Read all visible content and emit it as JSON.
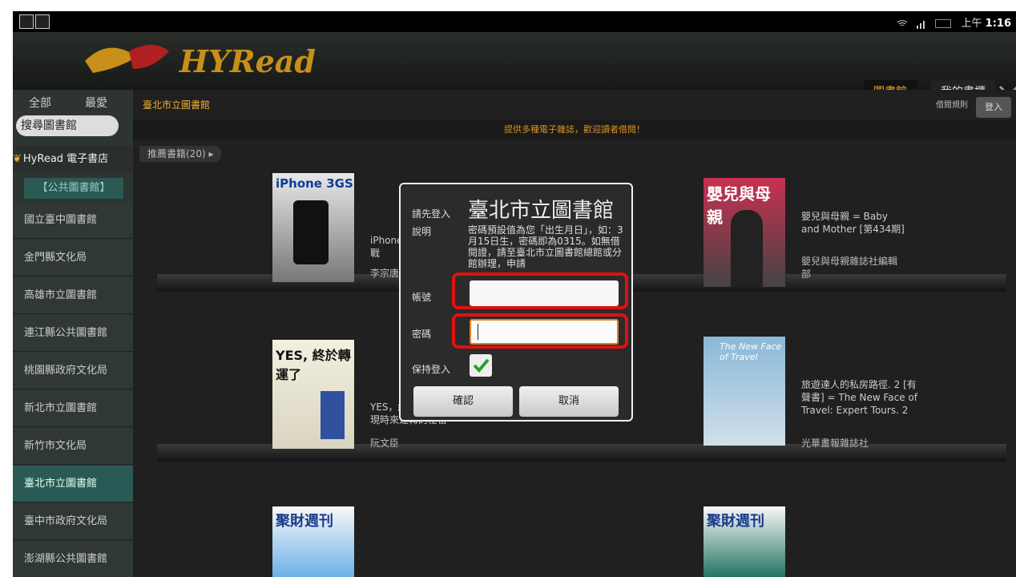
{
  "status_bar": {
    "time_prefix": "上午",
    "time": "1:16"
  },
  "header": {
    "logo_text": "HYRead",
    "tabs": [
      {
        "label": "圖書館",
        "active": true
      },
      {
        "label": "我的書櫃",
        "active": false
      }
    ]
  },
  "sidebar": {
    "tab_all": "全部",
    "tab_favorites": "最愛",
    "search_label": "搜尋圖書館",
    "store_label": "HyRead 電子書店",
    "category": "【公共圖書館】",
    "items": [
      "國立臺中圖書館",
      "金門縣文化局",
      "高雄市立圖書館",
      "連江縣公共圖書館",
      "桃園縣政府文化局",
      "新北市立圖書館",
      "新竹市文化局",
      "臺北市立圖書館",
      "臺中市政府文化局",
      "澎湖縣公共圖書館"
    ],
    "selected": "臺北市立圖書館"
  },
  "main": {
    "library_title": "臺北市立圖書館",
    "rules_label": "借閱規則",
    "login_label": "登入",
    "banner": "提供多種電子雜誌，歡迎讀者借閱！",
    "recommend_label": "推薦書籍(20)",
    "books": [
      {
        "cover": "iPhone 3GS",
        "title": "iPhone 3GS...\n戰",
        "author": "李宗唐"
      },
      {
        "cover": "嬰兒與母親",
        "title": "嬰兒與母親 = Baby and Mother [第434期]",
        "author": "嬰兒與母親雜誌社編輯部"
      },
      {
        "cover": "YES, 終於轉運了",
        "title": "YES，終...\n現時來運轉的秘密",
        "author": "阮文臣"
      },
      {
        "cover": "The New Face of Travel",
        "title": "旅遊達人的私房路徑. 2 [有聲書] = The New Face of Travel: Expert Tours. 2",
        "author": "光華畫報雜誌社"
      },
      {
        "cover": "聚財週刊",
        "title": "",
        "author": ""
      },
      {
        "cover": "聚財週刊",
        "title": "",
        "author": ""
      }
    ]
  },
  "dialog": {
    "prompt": "請先登入",
    "title": "臺北市立圖書館",
    "desc_label": "說明",
    "description": "密碼預設值為您「出生月日」，如：3月15日生，密碼即為0315。如無借閱證，請至臺北市立圖書館總館或分館辦理，申請",
    "account_label": "帳號",
    "password_label": "密碼",
    "account_value": "",
    "password_value": "",
    "keep_login_label": "保持登入",
    "keep_login_checked": true,
    "confirm_label": "確認",
    "cancel_label": "取消"
  }
}
